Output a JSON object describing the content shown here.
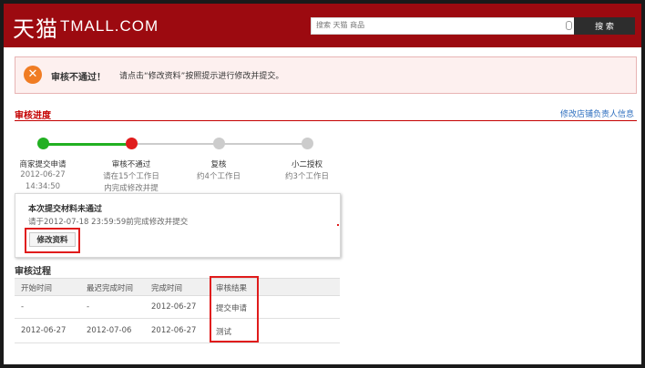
{
  "header": {
    "logo_cn": "天猫",
    "logo_en": "TMALL.COM",
    "search_placeholder": "搜索 天猫 商品",
    "search_button": "搜 索"
  },
  "alert": {
    "title": "审核不通过！",
    "message": "请点击“修改资料”按照提示进行修改并提交。"
  },
  "progress": {
    "section_title": "审核进度",
    "edit_owner_link": "修改店铺负责人信息",
    "steps": [
      {
        "name": "商家提交申请",
        "line1": "2012-06-27",
        "line2": "14:34:50",
        "status": "done",
        "color": "#22b022"
      },
      {
        "name": "审核不通过",
        "line1": "请在15个工作日",
        "line2": "内完成修改并提",
        "status": "failed",
        "color": "#e01c1c"
      },
      {
        "name": "复核",
        "line1": "约4个工作日",
        "line2": "",
        "status": "pending",
        "color": "#cccccc"
      },
      {
        "name": "小二授权",
        "line1": "约3个工作日",
        "line2": "",
        "status": "pending",
        "color": "#cccccc"
      }
    ]
  },
  "notice": {
    "title": "本次提交材料未通过",
    "text": "请于2012-07-18 23:59:59前完成修改并提交",
    "edit_button": "修改资料"
  },
  "process": {
    "section_title": "审核过程",
    "columns": [
      "开始时间",
      "最迟完成时间",
      "完成时间",
      "审核结果"
    ],
    "rows": [
      [
        "-",
        "-",
        "2012-06-27",
        "提交申请"
      ],
      [
        "2012-06-27",
        "2012-07-06",
        "2012-06-27",
        "测试"
      ]
    ]
  }
}
